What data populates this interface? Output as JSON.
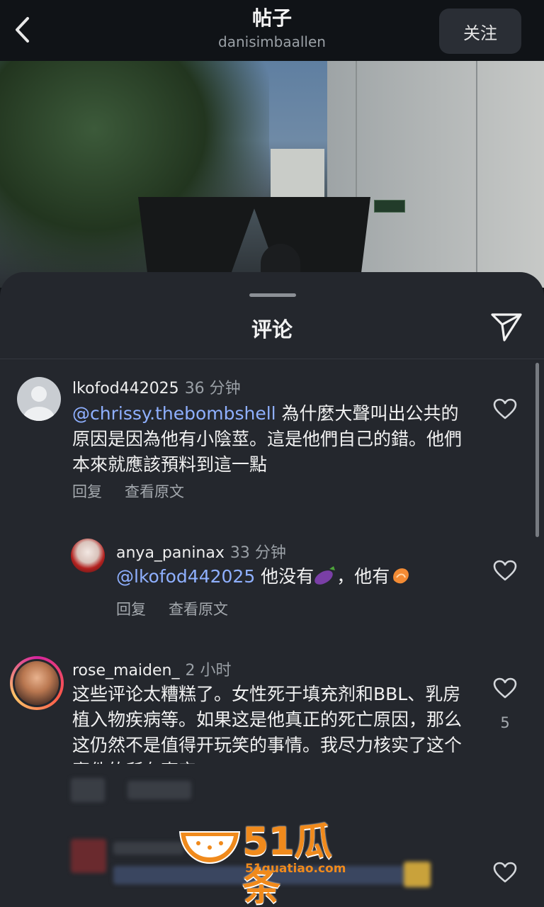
{
  "header": {
    "title": "帖子",
    "username": "danisimbaallen",
    "follow_label": "关注"
  },
  "sheet": {
    "title": "评论"
  },
  "comments": [
    {
      "username": "lkofod442025",
      "time": "36 分钟",
      "mention": "@chrissy.thebombshell",
      "text": " 為什麼大聲叫出公共的原因是因為他有小陰莖。這是他們自己的錯。他們本來就應該預料到這一點",
      "reply_label": "回复",
      "original_label": "查看原文"
    },
    {
      "username": "anya_paninax",
      "time": "33 分钟",
      "mention": "@lkofod442025",
      "text_a": " 他没有",
      "text_b": "，他有",
      "reply_label": "回复",
      "original_label": "查看原文"
    },
    {
      "username": "rose_maiden_",
      "time": "2 小时",
      "text": "这些评论太糟糕了。女性死于填充剂和BBL、乳房植入物疾病等。如果这是他真正的死亡原因，那么这仍然不是值得开玩笑的事情。我尽力核实了这个案件的所有事实",
      "likes": "5"
    }
  ],
  "watermark": {
    "brand": "51瓜条",
    "url": "51guatiao.com"
  },
  "colors": {
    "mention": "#8fb0ff",
    "sheet_bg": "#24272d",
    "watermark": "#f08a1c"
  }
}
